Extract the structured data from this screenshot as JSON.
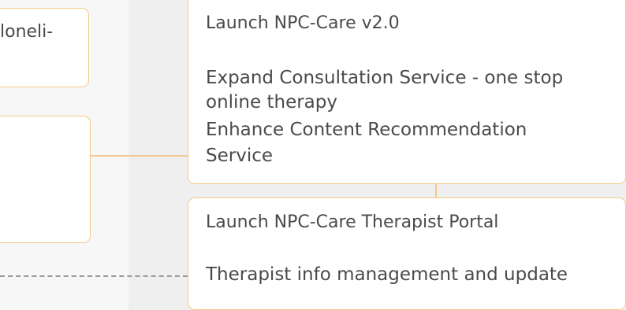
{
  "left_card_top": {
    "text": "loneli-"
  },
  "card_npc_care": {
    "title": "Launch NPC-Care v2.0",
    "lines": [
      "Expand Consultation Service - one stop",
      "online therapy",
      "Enhance Content Recommendation",
      "Service"
    ]
  },
  "card_therapist_portal": {
    "title": "Launch NPC-Care Therapist Portal",
    "desc": "Therapist info management and update"
  },
  "colors": {
    "card_border": "#f2c98a",
    "text": "#4a4a4a",
    "dashed_line": "#9a9a9a"
  }
}
